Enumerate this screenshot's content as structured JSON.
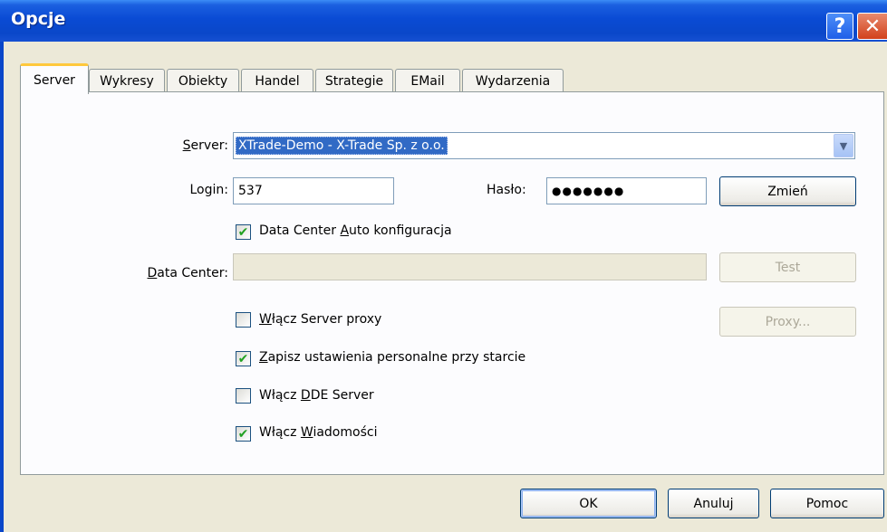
{
  "window": {
    "title": "Opcje",
    "help_glyph": "?",
    "close_glyph": "✕"
  },
  "tabs": [
    {
      "label": "Server",
      "active": true
    },
    {
      "label": "Wykresy"
    },
    {
      "label": "Obiekty"
    },
    {
      "label": "Handel"
    },
    {
      "label": "Strategie"
    },
    {
      "label": "EMail"
    },
    {
      "label": "Wydarzenia"
    }
  ],
  "server": {
    "label_pre": "",
    "label_u": "S",
    "label_post": "erver:",
    "value": "XTrade-Demo - X-Trade Sp. z o.o."
  },
  "login": {
    "label": "Login:",
    "value": "537"
  },
  "password": {
    "label": "Hasło:",
    "value": "●●●●●●●"
  },
  "change_button": "Zmień",
  "data_center_auto": {
    "label_pre": "Data Center ",
    "label_u": "A",
    "label_post": "uto konfiguracja",
    "checked": true
  },
  "data_center": {
    "label_pre": "",
    "label_u": "D",
    "label_post": "ata Center:",
    "value": ""
  },
  "test_button": "Test",
  "proxy_checkbox": {
    "label_pre": "",
    "label_u": "W",
    "label_post": "łącz Server proxy",
    "checked": false
  },
  "proxy_button": "Proxy...",
  "save_personal": {
    "label_pre": "",
    "label_u": "Z",
    "label_post": "apisz ustawienia personalne przy starcie",
    "checked": true
  },
  "dde_server": {
    "label_pre": "Włącz ",
    "label_u": "D",
    "label_post": "DE Server",
    "checked": false
  },
  "news": {
    "label_pre": "Włącz ",
    "label_u": "W",
    "label_post": "iadomości",
    "checked": true
  },
  "footer": {
    "ok": "OK",
    "cancel": "Anuluj",
    "help": "Pomoc"
  },
  "check_glyph": "✔",
  "combo_arrow_glyph": "▼",
  "colors": {
    "titlebar": "#0a47c9",
    "selection": "#316ac5",
    "active_tab_accent": "#ffc83c",
    "check": "#21a121"
  }
}
